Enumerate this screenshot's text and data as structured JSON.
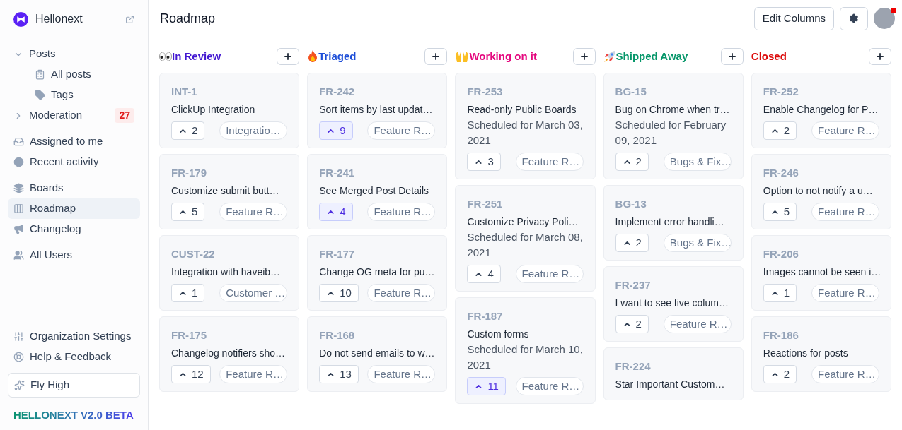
{
  "brand": {
    "name": "Hellonext"
  },
  "sidebar": {
    "items": [
      {
        "label": "Posts",
        "expanded": true,
        "children": [
          {
            "label": "All posts",
            "selected": false
          },
          {
            "label": "Tags",
            "selected": false
          }
        ]
      },
      {
        "label": "Moderation",
        "expanded": false,
        "badge": "27"
      },
      {
        "label": "Assigned to me",
        "selected": false
      },
      {
        "label": "Recent activity",
        "selected": false
      },
      {
        "label": "Boards",
        "selected": false
      },
      {
        "label": "Roadmap",
        "selected": true
      },
      {
        "label": "Changelog",
        "selected": false
      },
      {
        "label": "All Users",
        "selected": false
      }
    ],
    "bottom": [
      {
        "label": "Organization Settings"
      },
      {
        "label": "Help & Feedback"
      }
    ],
    "fly_high": "Fly High",
    "version": "HELLONEXT V2.0 BETA"
  },
  "header": {
    "title": "Roadmap",
    "edit_columns": "Edit Columns",
    "avatar_notification": true
  },
  "columns": [
    {
      "title": "In Review",
      "color": "#4318d1",
      "cards": [
        {
          "id": "INT-1",
          "title": "ClickUp Integration",
          "votes": "2",
          "voted": false,
          "tag": "Integratio…"
        },
        {
          "id": "FR-179",
          "title": "Customize submit butt…",
          "votes": "5",
          "voted": false,
          "tag": "Feature R…"
        },
        {
          "id": "CUST-22",
          "title": "Integration with haveib…",
          "votes": "1",
          "voted": false,
          "tag": "Customer …"
        },
        {
          "id": "FR-175",
          "title": "Changelog notifiers sho…",
          "votes": "12",
          "voted": false,
          "tag": "Feature R…"
        }
      ]
    },
    {
      "title": "Triaged",
      "color": "#1d4ed8",
      "cards": [
        {
          "id": "FR-242",
          "title": "Sort items by last updat…",
          "votes": "9",
          "voted": true,
          "tag": "Feature R…"
        },
        {
          "id": "FR-241",
          "title": "See Merged Post Details",
          "votes": "4",
          "voted": true,
          "tag": "Feature R…"
        },
        {
          "id": "FR-177",
          "title": "Change OG meta for pu…",
          "votes": "10",
          "voted": false,
          "tag": "Feature R…"
        },
        {
          "id": "FR-168",
          "title": "Do not send emails to w…",
          "votes": "13",
          "voted": false,
          "tag": "Feature R…"
        }
      ]
    },
    {
      "title": "Working on it",
      "color": "#e5097f",
      "cards": [
        {
          "id": "FR-253",
          "title": "Read-only Public Boards",
          "schedule": "Scheduled for March 03, 2021",
          "votes": "3",
          "voted": false,
          "tag": "Feature R…"
        },
        {
          "id": "FR-251",
          "title": "Customize Privacy Poli…",
          "schedule": "Scheduled for March 08, 2021",
          "votes": "4",
          "voted": false,
          "tag": "Feature R…"
        },
        {
          "id": "FR-187",
          "title": "Custom forms",
          "schedule": "Scheduled for March 10, 2021",
          "votes": "11",
          "voted": true,
          "tag": "Feature R…"
        }
      ]
    },
    {
      "title": "Shipped Away",
      "color": "#059669",
      "cards": [
        {
          "id": "BG-15",
          "title": "Bug on Chrome when tr…",
          "schedule": "Scheduled for February 09, 2021",
          "votes": "2",
          "voted": false,
          "tag": "Bugs & Fix…"
        },
        {
          "id": "BG-13",
          "title": "Implement error handli…",
          "votes": "2",
          "voted": false,
          "tag": "Bugs & Fix…"
        },
        {
          "id": "FR-237",
          "title": "I want to see five colum…",
          "votes": "2",
          "voted": false,
          "tag": "Feature R…"
        },
        {
          "id": "FR-224",
          "title": "Star Important Custom…"
        }
      ]
    },
    {
      "title": "Closed",
      "color": "#dc0a0a",
      "cards": [
        {
          "id": "FR-252",
          "title": "Enable Changelog for P…",
          "votes": "2",
          "voted": false,
          "tag": "Feature R…"
        },
        {
          "id": "FR-246",
          "title": "Option to not notify a u…",
          "votes": "5",
          "voted": false,
          "tag": "Feature R…"
        },
        {
          "id": "FR-206",
          "title": "Images cannot be seen i…",
          "votes": "1",
          "voted": false,
          "tag": "Feature R…"
        },
        {
          "id": "FR-186",
          "title": "Reactions for posts",
          "votes": "2",
          "voted": false,
          "tag": "Feature R…"
        }
      ]
    }
  ]
}
